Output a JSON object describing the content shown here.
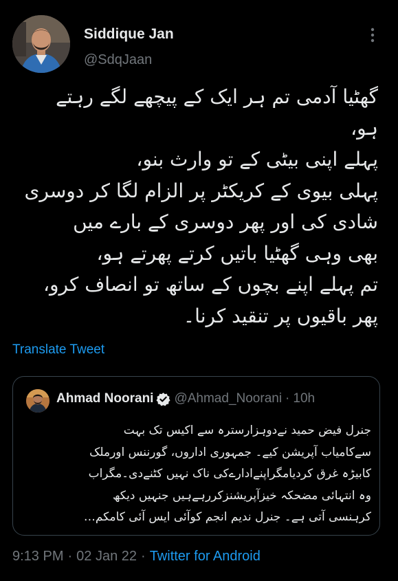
{
  "tweet": {
    "author": {
      "display_name": "Siddique Jan",
      "handle": "@SdqJaan"
    },
    "body_lines": [
      "گھٹیا آدمی تم ہر ایک کے پیچھے لگے رہتے",
      "ہو،",
      "پہلے اپنی بیٹی کے تو وارث بنو،",
      "پہلی بیوی کے کریکٹر پر الزام لگا کر دوسری",
      "شادی کی اور پھر دوسری کے بارے میں",
      "بھی وہی گھٹیا باتیں کرتے پھرتے ہو،",
      "تم پہلے اپنے بچوں کے ساتھ تو انصاف کرو،",
      "پھر باقیوں پر تنقید کرنا۔"
    ],
    "translate_label": "Translate Tweet",
    "quoted": {
      "display_name": "Ahmad Noorani",
      "handle": "@Ahmad_Noorani",
      "separator": "·",
      "time": "10h",
      "text_lines": [
        "جنرل فیض حمید نےدوہزارسترہ سے اکیس تک بہت",
        "سےکامیاب آپریشن کیے۔ جمہوری اداروں، گورننس اورملک",
        "کابیڑہ غرق کردیامگراپنےادارےکی ناک نہیں کٹنےدی۔مگراب",
        "وہ انتہائی مضحکہ خیزآپریشنزکررہےہیں جنہیں دیکھ",
        "کرہنسی آتی ہے۔ جنرل ندیم انجم کوآئی ایس آئی کامکم…"
      ]
    },
    "meta": {
      "time": "9:13 PM",
      "separator": "·",
      "date": "02 Jan 22",
      "source": "Twitter for Android"
    }
  },
  "icons": {
    "more": "more-vertical-icon",
    "verified": "verified-badge-icon"
  },
  "colors": {
    "background": "#000000",
    "text": "#e7e9ea",
    "secondary_text": "#71767b",
    "link": "#1d9bf0",
    "border": "#38444d"
  }
}
